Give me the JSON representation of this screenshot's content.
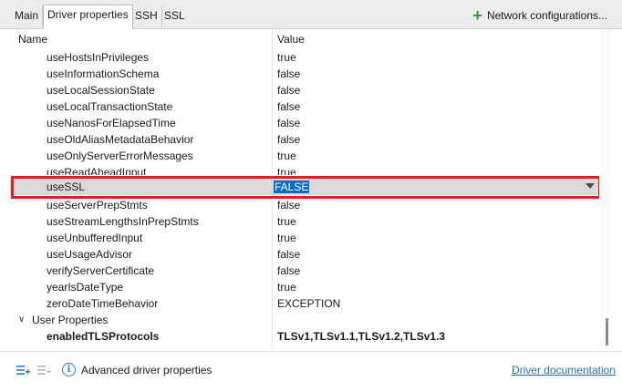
{
  "tabs": [
    {
      "label": "Main"
    },
    {
      "label": "Driver properties"
    },
    {
      "label": "SSH"
    },
    {
      "label": "SSL"
    }
  ],
  "network_config_label": "Network configurations...",
  "columns": {
    "name": "Name",
    "value": "Value"
  },
  "rows": [
    {
      "name": "useHostsInPrivileges",
      "value": "true"
    },
    {
      "name": "useInformationSchema",
      "value": "false"
    },
    {
      "name": "useLocalSessionState",
      "value": "false"
    },
    {
      "name": "useLocalTransactionState",
      "value": "false"
    },
    {
      "name": "useNanosForElapsedTime",
      "value": "false"
    },
    {
      "name": "useOldAliasMetadataBehavior",
      "value": "false"
    },
    {
      "name": "useOnlyServerErrorMessages",
      "value": "true"
    },
    {
      "name": "useReadAheadInput",
      "value": "true"
    },
    {
      "name": "useSSL",
      "value": "FALSE"
    },
    {
      "name": "useServerPrepStmts",
      "value": "false"
    },
    {
      "name": "useStreamLengthsInPrepStmts",
      "value": "true"
    },
    {
      "name": "useUnbufferedInput",
      "value": "true"
    },
    {
      "name": "useUsageAdvisor",
      "value": "false"
    },
    {
      "name": "verifyServerCertificate",
      "value": "false"
    },
    {
      "name": "yearIsDateType",
      "value": "true"
    },
    {
      "name": "zeroDateTimeBehavior",
      "value": "EXCEPTION"
    }
  ],
  "user_properties": {
    "label": "User Properties",
    "items": [
      {
        "name": "enabledTLSProtocols",
        "value": "TLSv1,TLSv1.1,TLSv1.2,TLSv1.3"
      }
    ]
  },
  "footer": {
    "advanced_label": "Advanced driver properties",
    "doc_link": "Driver documentation"
  },
  "colors": {
    "accent": "#0a6bd6",
    "highlight": "#e0201f",
    "add": "#2e9a3a"
  }
}
